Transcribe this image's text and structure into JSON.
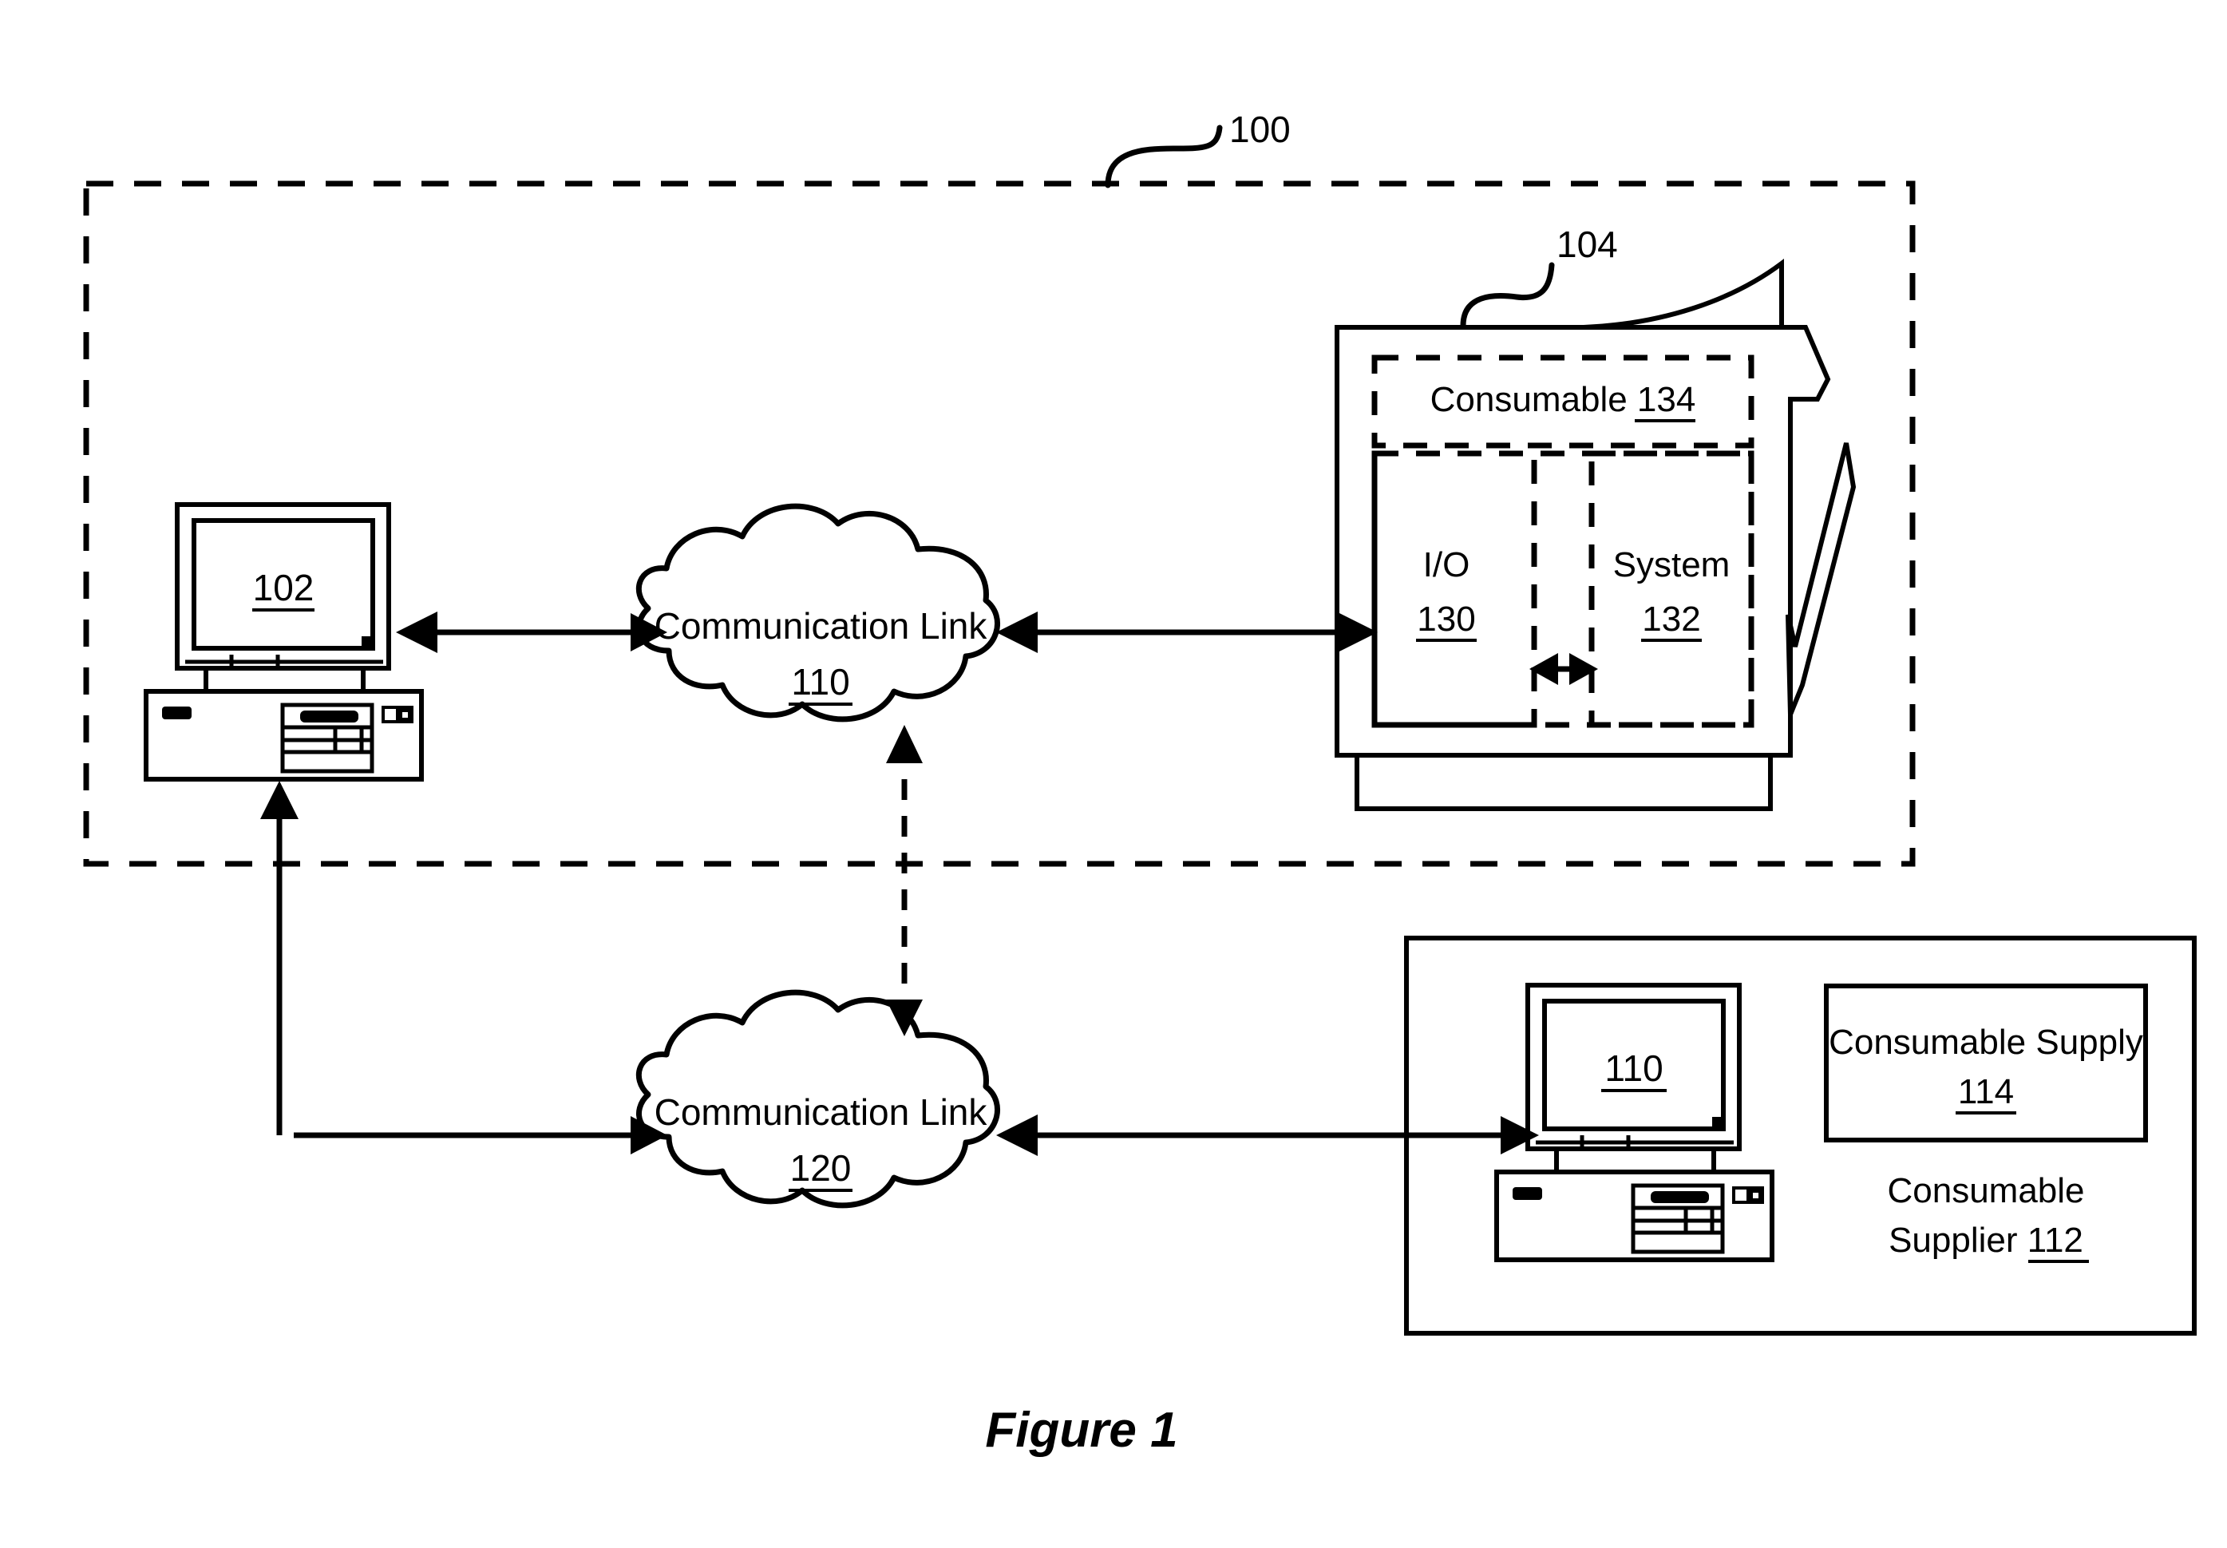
{
  "figure": {
    "caption": "Figure 1",
    "system_ref": "100",
    "device_ref": "104"
  },
  "boundary": {
    "name": "system-boundary",
    "ref": "100"
  },
  "workstation": {
    "screen_ref": "102"
  },
  "link_upper": {
    "label": "Communication Link",
    "ref": "110"
  },
  "link_lower": {
    "label": "Communication Link",
    "ref": "120"
  },
  "printer": {
    "ref": "104",
    "consumable": {
      "label": "Consumable",
      "ref": "134"
    },
    "io": {
      "label": "I/O",
      "ref": "130"
    },
    "system": {
      "label": "System",
      "ref": "132"
    }
  },
  "supplier": {
    "name_line1": "Consumable",
    "name_line2": "Supplier",
    "ref": "112",
    "computer_screen_ref": "110",
    "supply": {
      "label": "Consumable Supply",
      "ref": "114"
    }
  },
  "colors": {
    "ink": "#000000",
    "paper": "#ffffff"
  }
}
